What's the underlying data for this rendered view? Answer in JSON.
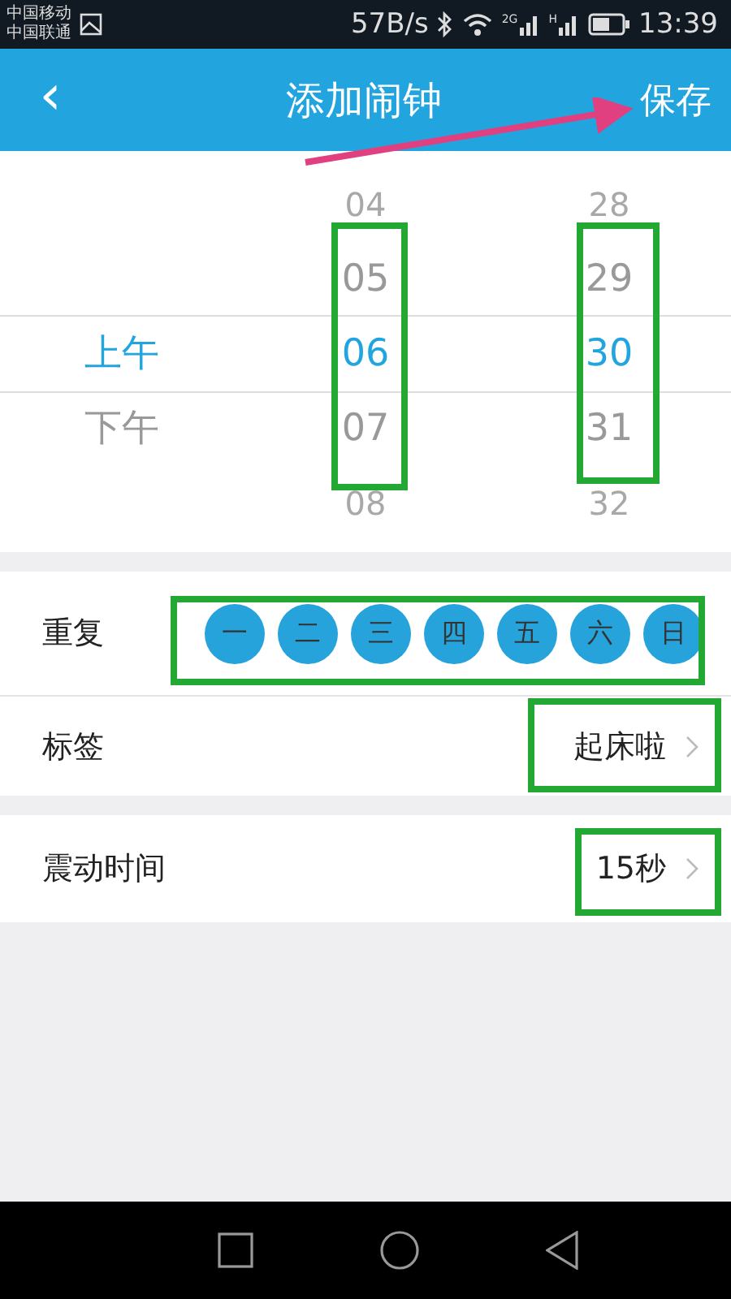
{
  "status_bar": {
    "carriers": [
      "中国移动",
      "中国联通"
    ],
    "speed": "57B/s",
    "signal_labels": [
      "2G",
      "H"
    ],
    "time": "13:39"
  },
  "app_bar": {
    "back": "‹",
    "title": "添加闹钟",
    "action": "保存"
  },
  "picker": {
    "columns": [
      {
        "kind": "period",
        "items": [
          {
            "text": "上午",
            "selected": true,
            "faded": false
          },
          {
            "text": "下午",
            "selected": false,
            "faded": false
          }
        ]
      },
      {
        "kind": "number",
        "items": [
          {
            "text": "04",
            "selected": false,
            "faded": true
          },
          {
            "text": "05",
            "selected": false,
            "faded": false
          },
          {
            "text": "06",
            "selected": true,
            "faded": false
          },
          {
            "text": "07",
            "selected": false,
            "faded": false
          },
          {
            "text": "08",
            "selected": false,
            "faded": true
          }
        ]
      },
      {
        "kind": "number",
        "items": [
          {
            "text": "28",
            "selected": false,
            "faded": true
          },
          {
            "text": "29",
            "selected": false,
            "faded": false
          },
          {
            "text": "30",
            "selected": true,
            "faded": false
          },
          {
            "text": "31",
            "selected": false,
            "faded": false
          },
          {
            "text": "32",
            "selected": false,
            "faded": true
          }
        ]
      }
    ]
  },
  "repeat": {
    "label": "重复",
    "days": [
      {
        "text": "一",
        "selected": true
      },
      {
        "text": "二",
        "selected": true
      },
      {
        "text": "三",
        "selected": true
      },
      {
        "text": "四",
        "selected": true
      },
      {
        "text": "五",
        "selected": true
      },
      {
        "text": "六",
        "selected": true
      },
      {
        "text": "日",
        "selected": true
      }
    ]
  },
  "tag": {
    "label": "标签",
    "value": "起床啦"
  },
  "vibration": {
    "label": "震动时间",
    "value": "15秒"
  }
}
